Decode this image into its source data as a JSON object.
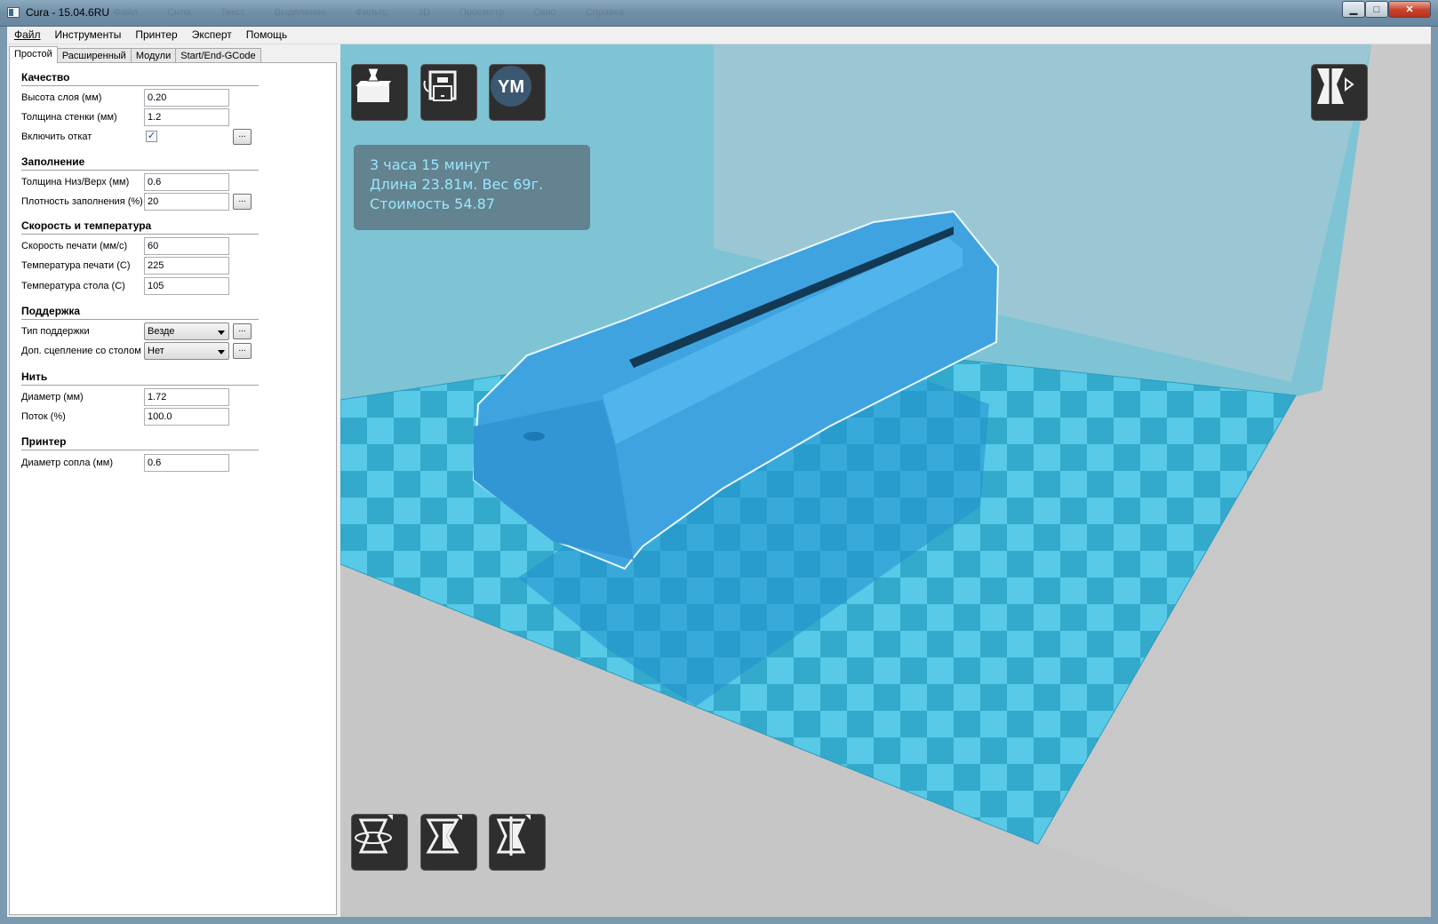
{
  "window": {
    "title": "Cura - 15.04.6RU",
    "ghost_menu": "Файл Сила Текст Выделение Фильтр 3D Просмотр Окно Справка",
    "minimize_label": "▁",
    "maximize_label": "□",
    "close_label": "✕"
  },
  "menu": [
    "Файл",
    "Инструменты",
    "Принтер",
    "Эксперт",
    "Помощь"
  ],
  "tabs": [
    "Простой",
    "Расширенный",
    "Модули",
    "Start/End-GCode"
  ],
  "more_label": "...",
  "sections": {
    "quality": {
      "title": "Качество",
      "layer_height_label": "Высота слоя (мм)",
      "layer_height": "0.20",
      "wall_label": "Толщина стенки (мм)",
      "wall": "1.2",
      "retract_label": "Включить откат",
      "retract_mark": "✓"
    },
    "fill": {
      "title": "Заполнение",
      "bottom_top_label": "Толщина Низ/Верх (мм)",
      "bottom_top": "0.6",
      "density_label": "Плотность заполнения (%)",
      "density": "20"
    },
    "speed": {
      "title": "Скорость и температура",
      "print_speed_label": "Скорость печати (мм/с)",
      "print_speed": "60",
      "print_temp_label": "Температура печати (С)",
      "print_temp": "225",
      "bed_temp_label": "Температура стола (С)",
      "bed_temp": "105"
    },
    "support": {
      "title": "Поддержка",
      "type_label": "Тип поддержки",
      "type_value": "Везде",
      "adhesion_label": "Доп. сцепление со столом",
      "adhesion_value": "Нет"
    },
    "filament": {
      "title": "Нить",
      "diameter_label": "Диаметр (мм)",
      "diameter": "1.72",
      "flow_label": "Поток (%)",
      "flow": "100.0"
    },
    "printer": {
      "title": "Принтер",
      "nozzle_label": "Диаметр сопла (мм)",
      "nozzle": "0.6"
    }
  },
  "viewport": {
    "info_time": "3 часа 15 минут",
    "info_length_weight": "Длина 23.81м. Вес 69г.",
    "info_cost": "Стоимость 54.87",
    "ym_label": "YM",
    "colors": {
      "model": "#3d9fdc",
      "bed_light": "#56c8e6",
      "bed_dark": "#2fa6c8",
      "wall": "#7fbfd0"
    }
  }
}
